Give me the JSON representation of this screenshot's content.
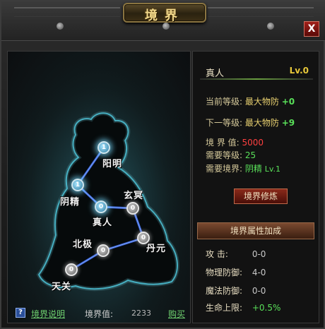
{
  "window": {
    "title": "境界",
    "close_label": "X"
  },
  "map": {
    "nodes": [
      {
        "id": "yangming",
        "label": "阳明",
        "level": "1",
        "state": "active"
      },
      {
        "id": "yinjing",
        "label": "阴精",
        "level": "1",
        "state": "active"
      },
      {
        "id": "zhenren",
        "label": "真人",
        "level": "0",
        "state": "active"
      },
      {
        "id": "xuanming",
        "label": "玄冥",
        "level": "0",
        "state": "inactive"
      },
      {
        "id": "danyuan",
        "label": "丹元",
        "level": "0",
        "state": "inactive"
      },
      {
        "id": "beiji",
        "label": "北极",
        "level": "0",
        "state": "inactive"
      },
      {
        "id": "tianguan",
        "label": "天关",
        "level": "0",
        "state": "inactive"
      }
    ]
  },
  "footer": {
    "help_icon": "?",
    "help_link": "境界说明",
    "realm_value_label": "境界值:",
    "realm_value": "2233",
    "buy_link": "购买"
  },
  "detail": {
    "name": "真人",
    "level": "Lv.0",
    "current_level_label": "当前等级:",
    "current_level_attr": "最大物防",
    "current_level_value": "+0",
    "next_level_label": "下一等级:",
    "next_level_attr": "最大物防",
    "next_level_value": "+9",
    "realm_value_label": "境 界 值:",
    "realm_value": "5000",
    "req_level_label": "需要等级:",
    "req_level": "25",
    "req_realm_label": "需要境界:",
    "req_realm": "阴精",
    "req_realm_lv": "Lv.1",
    "cultivate_button": "境界修炼",
    "bonus_header": "境界属性加成",
    "stats": [
      {
        "label": "攻    击:",
        "value": "0-0"
      },
      {
        "label": "物理防御:",
        "value": "4-0"
      },
      {
        "label": "魔法防御:",
        "value": "0-0"
      },
      {
        "label": "生命上限:",
        "value": "+0.5%"
      }
    ]
  }
}
